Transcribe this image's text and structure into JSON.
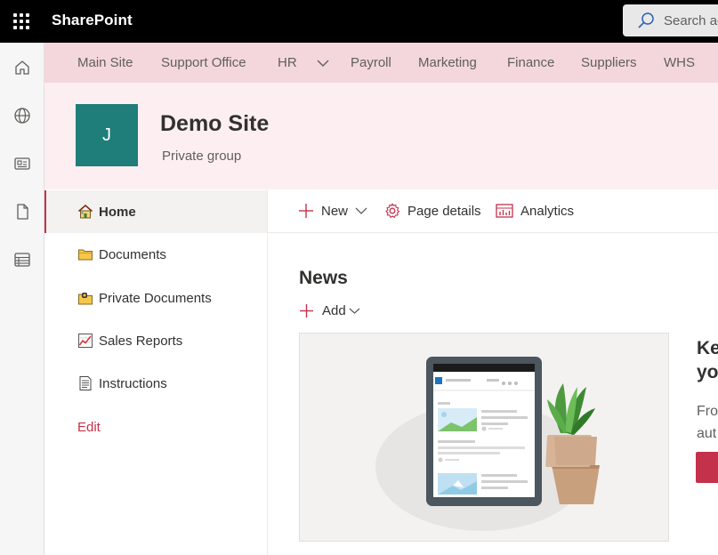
{
  "suite_bar": {
    "app_name": "SharePoint",
    "search_placeholder": "Search ac"
  },
  "app_bar": {
    "items": [
      "home-icon",
      "globe-icon",
      "news-icon",
      "file-icon",
      "list-icon"
    ]
  },
  "hub_nav": {
    "items": [
      {
        "label": "Main Site"
      },
      {
        "label": "Support Office"
      },
      {
        "label": "HR"
      },
      {
        "label": "Payroll"
      },
      {
        "label": "Marketing"
      },
      {
        "label": "Finance"
      },
      {
        "label": "Suppliers"
      },
      {
        "label": "WHS"
      }
    ]
  },
  "site_header": {
    "logo_letter": "J",
    "title": "Demo Site",
    "subtitle": "Private group"
  },
  "left_nav": {
    "items": [
      {
        "label": "Home",
        "icon": "house-icon",
        "selected": true
      },
      {
        "label": "Documents",
        "icon": "folder-icon"
      },
      {
        "label": "Private Documents",
        "icon": "locked-folder-icon"
      },
      {
        "label": "Sales Reports",
        "icon": "chart-icon"
      },
      {
        "label": "Instructions",
        "icon": "document-icon"
      }
    ],
    "edit_label": "Edit"
  },
  "command_bar": {
    "new_label": "New",
    "page_details_label": "Page details",
    "analytics_label": "Analytics"
  },
  "news": {
    "title": "News",
    "add_label": "Add"
  },
  "promo": {
    "title_line1": "Ke",
    "title_line2": "yo",
    "desc_line1": "Fro",
    "desc_line2": "aut"
  },
  "colors": {
    "suite_bar": "#000000",
    "hub_nav": "#f4d7dc",
    "site_header": "#fdeff1",
    "logo": "#1f7d7a",
    "accent": "#c4314b"
  }
}
